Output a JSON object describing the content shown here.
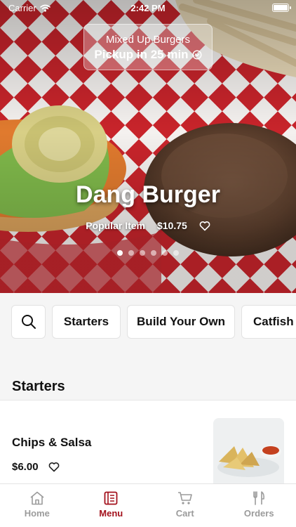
{
  "status_bar": {
    "carrier": "Carrier",
    "time": "2:42 PM"
  },
  "header": {
    "restaurant": "Mixed Up Burgers",
    "pickup": "Pickup in 25 min"
  },
  "featured": {
    "title": "Dang Burger",
    "label": "Popular Item",
    "price": "$10.75",
    "carousel_count": 6,
    "carousel_active_index": 0
  },
  "categories": {
    "items": [
      "Starters",
      "Build Your Own",
      "Catfish"
    ]
  },
  "section": {
    "title": "Starters"
  },
  "items": [
    {
      "name": "Chips & Salsa",
      "price": "$6.00"
    }
  ],
  "tabs": [
    {
      "label": "Home",
      "icon": "home-icon"
    },
    {
      "label": "Menu",
      "icon": "menu-icon",
      "active": true
    },
    {
      "label": "Cart",
      "icon": "cart-icon"
    },
    {
      "label": "Orders",
      "icon": "fork-knife-icon"
    }
  ],
  "colors": {
    "accent": "#a3111c",
    "checker_red": "#c8242b"
  }
}
